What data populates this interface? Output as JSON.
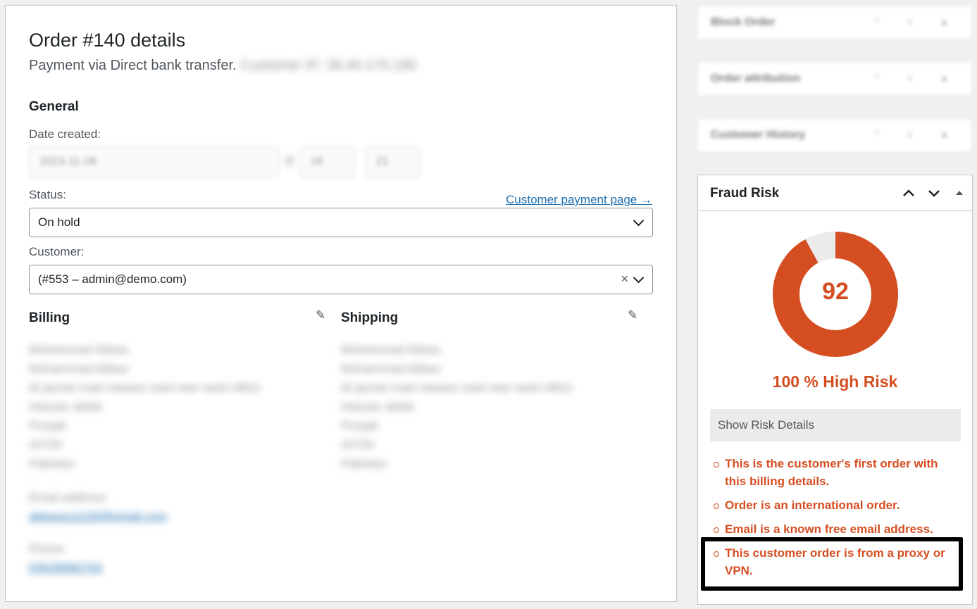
{
  "order": {
    "title": "Order #140 details",
    "subtitle": "Payment via Direct bank transfer.",
    "subtitle_blurred": "Customer IP: 39.40.170.180",
    "general_title": "General",
    "date_label": "Date created:",
    "date_value": "2023-11-28",
    "date_at": "@",
    "hour_value": "16",
    "minute_value": "21",
    "status_label": "Status:",
    "payment_link": "Customer payment page →",
    "status_value": "On hold",
    "customer_label": "Customer:",
    "customer_value": "(#553 – admin@demo.com)",
    "clear_symbol": "×",
    "billing_title": "Billing",
    "shipping_title": "Shipping",
    "billing_lines": [
      "Mohammad Abbas",
      "Mohammad Abbas",
      "Al jannat main hasara road near ward office",
      "Hassan abdal",
      "Punjab",
      "43750",
      "Pakistan"
    ],
    "shipping_lines": [
      "Mohammad Abbas",
      "Mohammad Abbas",
      "Al jannat main hasara road near ward office",
      "Hassan abdal",
      "Punjab",
      "43750",
      "Pakistan"
    ],
    "email_label": "Email address:",
    "email_value": "abbasnu1100@email.com",
    "phone_label": "Phone:",
    "phone_value": "03028080704"
  },
  "sidebar": {
    "blurred_boxes": [
      "Block Order",
      "Order attribution",
      "Customer History"
    ],
    "box_arrows": "^ v ▲"
  },
  "fraud": {
    "title": "Fraud Risk",
    "score": "92",
    "score_value": 92,
    "risk_label": "100 % High Risk",
    "details_button": "Show Risk Details",
    "reasons": [
      "This is the customer's first order with this billing details.",
      "Order is an international order.",
      "Email is a known free email address.",
      "This customer order is from a proxy or VPN."
    ]
  },
  "colors": {
    "risk": "#d54e21",
    "donut_rest": "#ebebeb",
    "link": "#2271b1"
  }
}
